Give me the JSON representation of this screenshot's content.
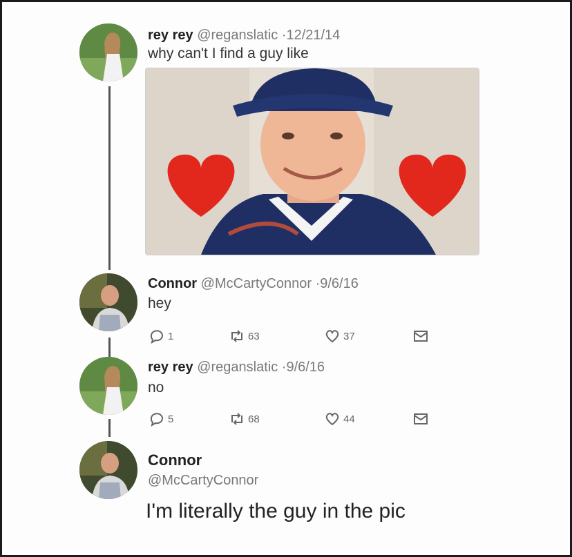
{
  "tweets": [
    {
      "name": "rey rey",
      "handle": "@reganslatic",
      "date": "12/21/14",
      "text": "why can't I find a guy like",
      "avatar_icon": "woman-portrait-avatar"
    },
    {
      "name": "Connor",
      "handle": "@McCartyConnor",
      "date": "9/6/16",
      "text": "hey",
      "avatar_icon": "man-portrait-avatar",
      "replies": "1",
      "retweets": "63",
      "likes": "37"
    },
    {
      "name": "rey rey",
      "handle": "@reganslatic",
      "date": "9/6/16",
      "text": "no",
      "avatar_icon": "woman-portrait-avatar",
      "replies": "5",
      "retweets": "68",
      "likes": "44"
    }
  ],
  "final_tweet": {
    "name": "Connor",
    "handle": "@McCartyConnor",
    "text": "I'm literally the guy in the pic",
    "avatar_icon": "man-portrait-avatar"
  },
  "media": {
    "description_icon": "photo-smiling-guy-baseball-cap-hearts"
  },
  "colors": {
    "heart": "#e2271c",
    "cap": "#1f2f63",
    "name_text": "#222222",
    "meta_text": "#7a7a7a",
    "icon": "#666666"
  }
}
